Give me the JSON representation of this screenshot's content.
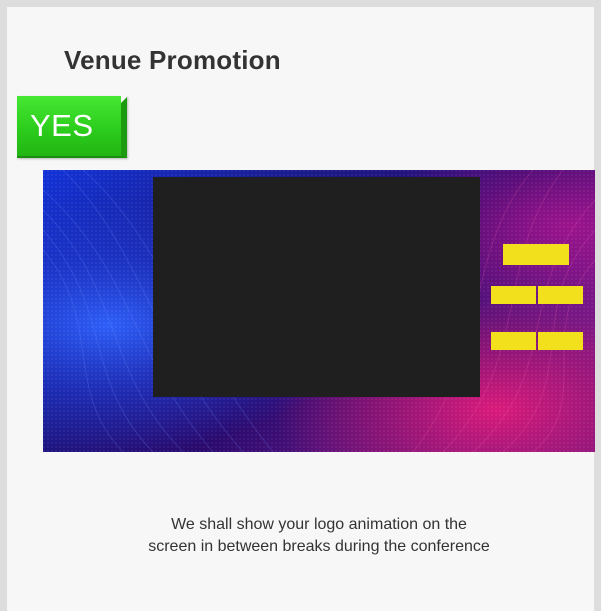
{
  "card": {
    "title": "Venue Promotion",
    "badge": "YES",
    "caption_line1": "We shall show your logo animation on the",
    "caption_line2": "screen in between breaks during the conference"
  },
  "image": {
    "icon": "venue-screen-mockup",
    "screen_color": "#1f1f1f",
    "logo_block_color": "#f2e01c",
    "background_colors": [
      "#1233d8",
      "#2a0a6e",
      "#c0167a"
    ]
  }
}
